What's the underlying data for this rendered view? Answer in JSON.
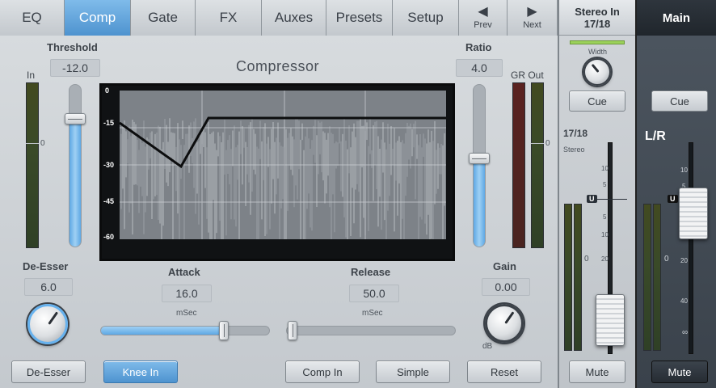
{
  "tabs": [
    {
      "label": "EQ",
      "active": false
    },
    {
      "label": "Comp",
      "active": true
    },
    {
      "label": "Gate",
      "active": false
    },
    {
      "label": "FX",
      "active": false
    },
    {
      "label": "Auxes",
      "active": false
    },
    {
      "label": "Presets",
      "active": false
    },
    {
      "label": "Setup",
      "active": false
    }
  ],
  "nav": {
    "prev": "Prev",
    "next": "Next",
    "prev_glyph": "◀",
    "next_glyph": "▶"
  },
  "compressor": {
    "title": "Compressor",
    "in_label": "In",
    "in_zero": "0",
    "threshold": {
      "label": "Threshold",
      "value": "-12.0"
    },
    "ratio": {
      "label": "Ratio",
      "value": "4.0"
    },
    "gr_out": {
      "label": "GR Out",
      "zero": "0"
    },
    "graph_scale": [
      "0",
      "-15",
      "-30",
      "-45",
      "-60"
    ],
    "de_esser": {
      "label": "De-Esser",
      "value": "6.0"
    },
    "attack": {
      "label": "Attack",
      "value": "16.0",
      "unit": "mSec"
    },
    "release": {
      "label": "Release",
      "value": "50.0",
      "unit": "mSec"
    },
    "gain": {
      "label": "Gain",
      "value": "0.00",
      "unit": "dB"
    }
  },
  "buttons": {
    "de_esser": "De-Esser",
    "knee_in": "Knee In",
    "comp_in": "Comp In",
    "simple": "Simple",
    "reset": "Reset"
  },
  "stereo_strip": {
    "title_line1": "Stereo In",
    "title_line2": "17/18",
    "width_label": "Width",
    "cue": "Cue",
    "channel": "17/18",
    "sub": "Stereo",
    "scale": [
      "10",
      "5",
      "U",
      "5",
      "10",
      "20",
      "0"
    ],
    "mute": "Mute"
  },
  "main_strip": {
    "title": "Main",
    "cue": "Cue",
    "lr": "L/R",
    "scale": [
      "10",
      "5",
      "U",
      "5",
      "10",
      "20",
      "0",
      "40",
      "∞"
    ],
    "mute": "Mute"
  },
  "colors": {
    "accent": "#4e93cf",
    "meter_green": "#3a4a28",
    "meter_red": "#4a2420"
  }
}
